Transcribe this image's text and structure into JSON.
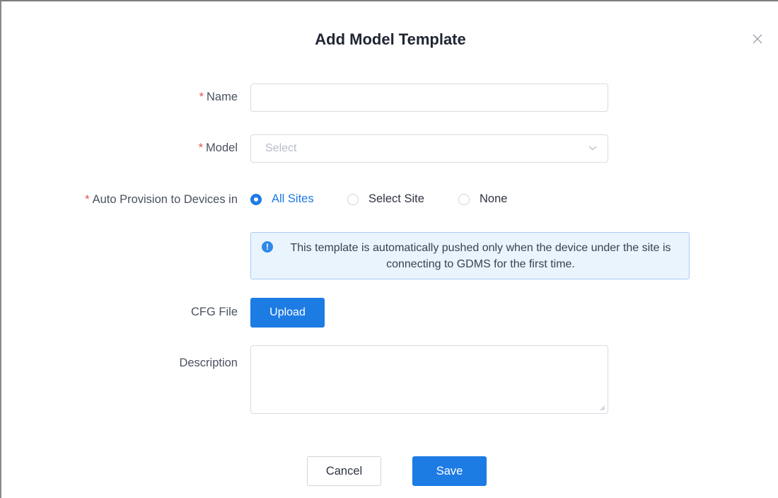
{
  "dialog": {
    "title": "Add Model Template",
    "close_icon": "close-icon"
  },
  "form": {
    "name": {
      "required_mark": "*",
      "label": "Name",
      "value": "",
      "placeholder": ""
    },
    "model": {
      "required_mark": "*",
      "label": "Model",
      "placeholder": "Select",
      "icon": "chevron-down-icon"
    },
    "auto_provision": {
      "required_mark": "*",
      "label": "Auto Provision to Devices in",
      "options": [
        {
          "label": "All Sites",
          "selected": true
        },
        {
          "label": "Select Site",
          "selected": false
        },
        {
          "label": "None",
          "selected": false
        }
      ]
    },
    "notice": {
      "icon": "info-icon",
      "icon_glyph": "!",
      "text": "This template is automatically pushed only when the device under the site is connecting to GDMS for the first time."
    },
    "cfg_file": {
      "label": "CFG File",
      "button_label": "Upload"
    },
    "description": {
      "label": "Description",
      "value": ""
    }
  },
  "footer": {
    "cancel_label": "Cancel",
    "save_label": "Save"
  },
  "colors": {
    "accent": "#1d7be4",
    "required": "#e5544c",
    "notice_bg": "#eaf4fd",
    "notice_border": "#a8cdf3"
  }
}
